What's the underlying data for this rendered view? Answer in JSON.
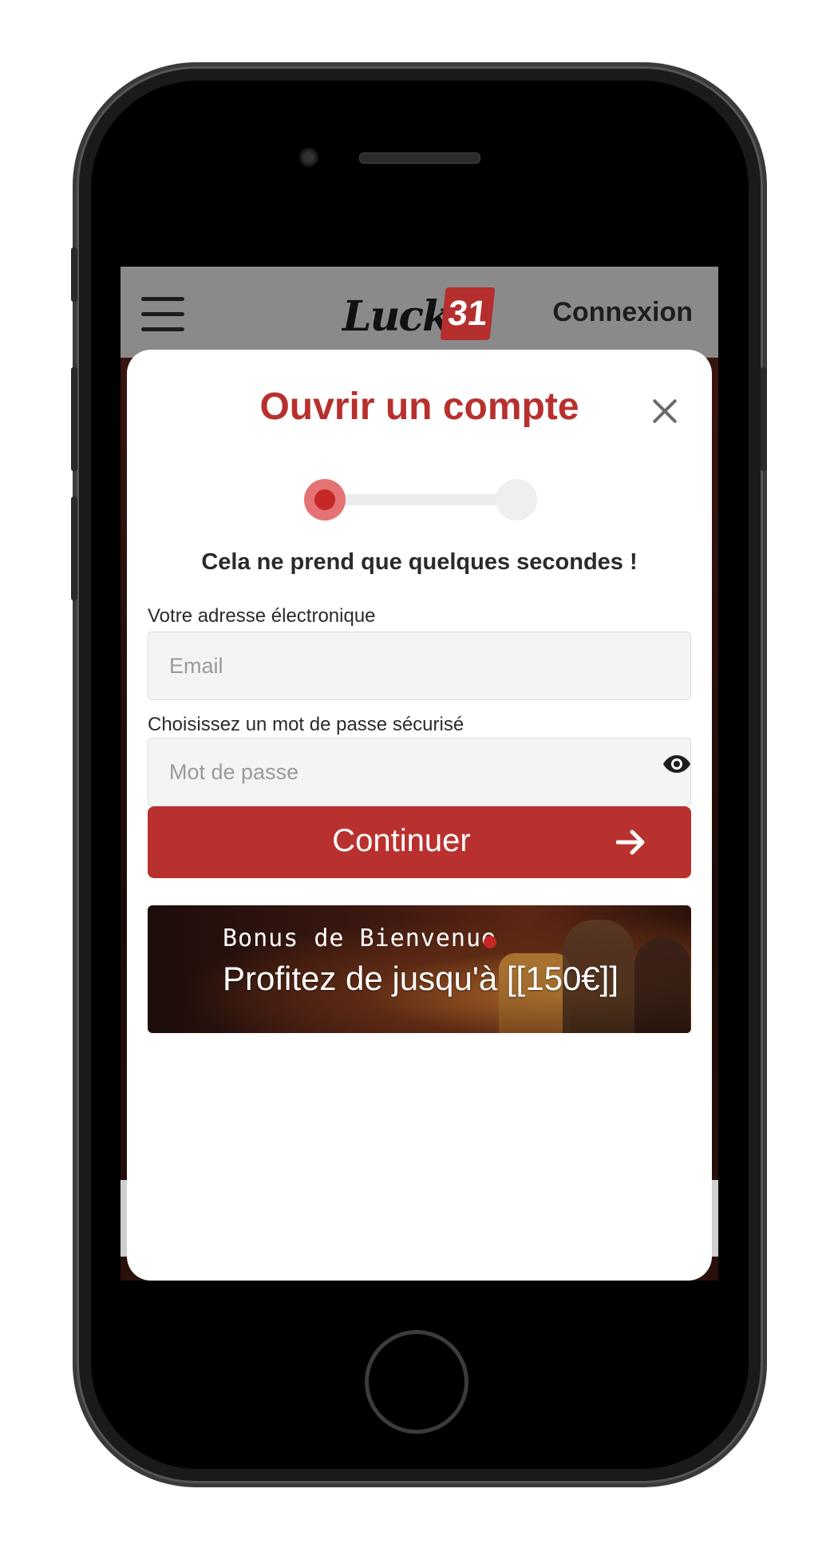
{
  "header": {
    "logo_text": "Lucky",
    "logo_number": "31",
    "login_label": "Connexion"
  },
  "modal": {
    "title": "Ouvrir un compte",
    "subtitle": "Cela ne prend que quelques secondes !",
    "step_current": 1,
    "step_total": 2,
    "email": {
      "label": "Votre adresse électronique",
      "placeholder": "Email",
      "value": ""
    },
    "password": {
      "label": "Choisissez un mot de passe sécurisé",
      "placeholder": "Mot de passe",
      "value": ""
    },
    "continue_label": "Continuer",
    "banner": {
      "title": "Bonus de Bienvenue",
      "text": "Profitez de jusqu'à [[150€]]"
    }
  },
  "colors": {
    "accent": "#b9312f",
    "header_bg": "#8a8a8a",
    "step_active": "#c62828"
  }
}
